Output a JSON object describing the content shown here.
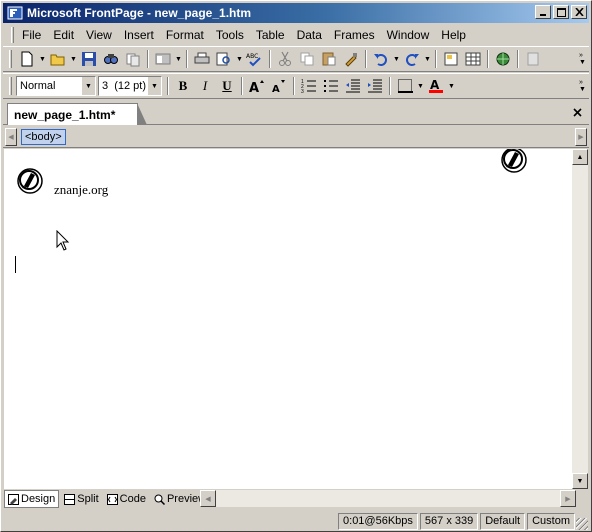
{
  "window": {
    "title": "Microsoft FrontPage - new_page_1.htm",
    "controls": [
      "minimize",
      "maximize",
      "close"
    ]
  },
  "menubar": {
    "items": [
      {
        "label": "File"
      },
      {
        "label": "Edit"
      },
      {
        "label": "View"
      },
      {
        "label": "Insert"
      },
      {
        "label": "Format"
      },
      {
        "label": "Tools"
      },
      {
        "label": "Table"
      },
      {
        "label": "Data"
      },
      {
        "label": "Frames"
      },
      {
        "label": "Window"
      },
      {
        "label": "Help"
      }
    ]
  },
  "standard_toolbar": {
    "icons": [
      "new-page-icon",
      "open-icon",
      "save-icon",
      "search-icon",
      "publish-icon",
      "folder-list-icon",
      "print-icon",
      "preview-icon",
      "spelling-icon",
      "cut-icon",
      "copy-icon",
      "paste-icon",
      "format-painter-icon",
      "undo-icon",
      "redo-icon",
      "insert-component-icon",
      "insert-table-icon",
      "hyperlink-icon",
      "web-component-icon"
    ]
  },
  "formatting_toolbar": {
    "style_value": "Normal",
    "font_size_value": "3  (12 pt)",
    "bold": "B",
    "italic": "I",
    "underline": "U",
    "font_color": "#ff0000"
  },
  "document": {
    "tab_label": "new_page_1.htm*",
    "tag": "<body>",
    "text": "znanje.org"
  },
  "view_tabs": [
    {
      "label": "Design",
      "active": true
    },
    {
      "label": "Split",
      "active": false
    },
    {
      "label": "Code",
      "active": false
    },
    {
      "label": "Preview",
      "active": false
    }
  ],
  "statusbar": {
    "download_time": "0:01@56Kbps",
    "dimensions": "567 x 339",
    "mode": "Default",
    "layout": "Custom"
  }
}
